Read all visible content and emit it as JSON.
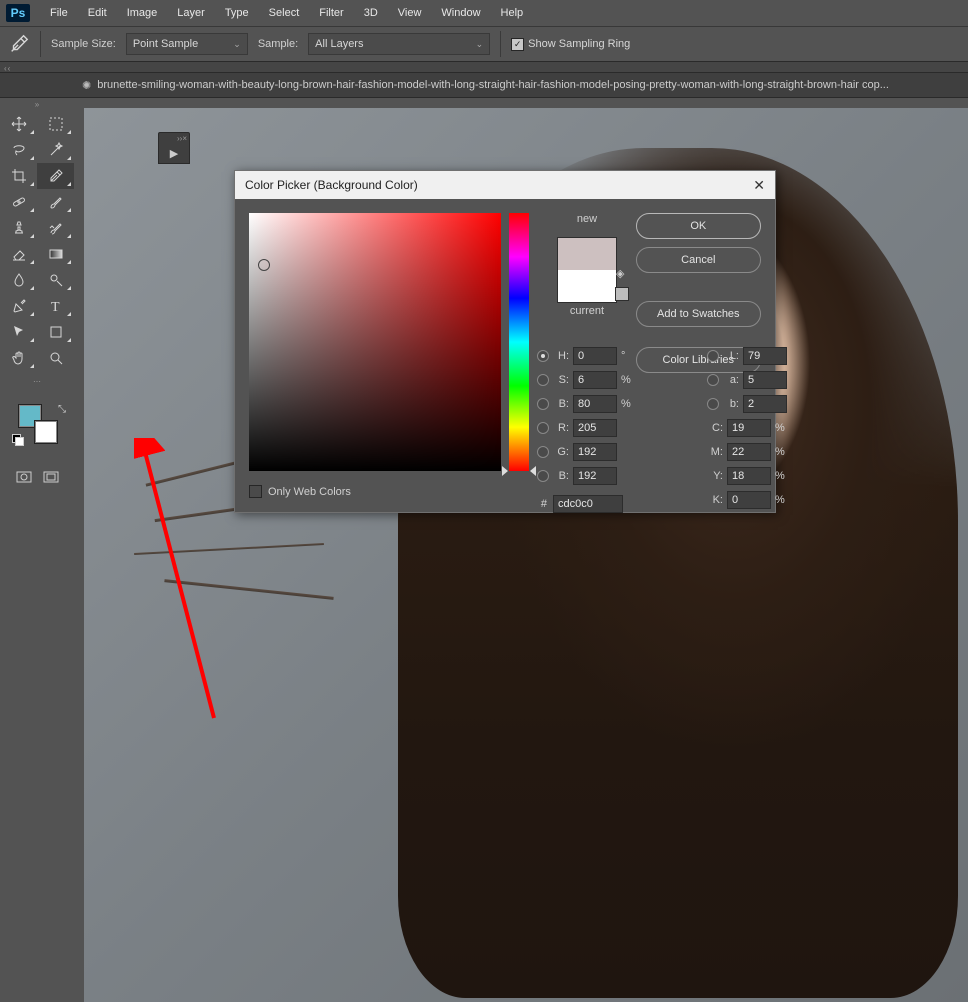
{
  "menu": {
    "items": [
      "File",
      "Edit",
      "Image",
      "Layer",
      "Type",
      "Select",
      "Filter",
      "3D",
      "View",
      "Window",
      "Help"
    ]
  },
  "options": {
    "sampleSizeLabel": "Sample Size:",
    "sampleSizeValue": "Point Sample",
    "sampleLabel": "Sample:",
    "sampleValue": "All Layers",
    "showRing": "Show Sampling Ring"
  },
  "tab": {
    "name": "brunette-smiling-woman-with-beauty-long-brown-hair-fashion-model-with-long-straight-hair-fashion-model-posing-pretty-woman-with-long-straight-brown-hair cop..."
  },
  "swatch": {
    "fg": "#64b9c8",
    "bg": "#ffffff"
  },
  "dialog": {
    "title": "Color Picker (Background Color)",
    "newLabel": "new",
    "currentLabel": "current",
    "newColor": "#cdc0c0",
    "currentColor": "#ffffff",
    "ok": "OK",
    "cancel": "Cancel",
    "addSwatch": "Add to Swatches",
    "colorLib": "Color Libraries",
    "webOnly": "Only Web Colors",
    "H": {
      "label": "H:",
      "val": "0",
      "unit": "°"
    },
    "S": {
      "label": "S:",
      "val": "6",
      "unit": "%"
    },
    "Bv": {
      "label": "B:",
      "val": "80",
      "unit": "%"
    },
    "R": {
      "label": "R:",
      "val": "205"
    },
    "G": {
      "label": "G:",
      "val": "192"
    },
    "Bc": {
      "label": "B:",
      "val": "192"
    },
    "L": {
      "label": "L:",
      "val": "79"
    },
    "a": {
      "label": "a:",
      "val": "5"
    },
    "b": {
      "label": "b:",
      "val": "2"
    },
    "C": {
      "label": "C:",
      "val": "19",
      "unit": "%"
    },
    "M": {
      "label": "M:",
      "val": "22",
      "unit": "%"
    },
    "Y": {
      "label": "Y:",
      "val": "18",
      "unit": "%"
    },
    "K": {
      "label": "K:",
      "val": "0",
      "unit": "%"
    },
    "hex": "cdc0c0",
    "svX": "6",
    "svY": "20",
    "hueY": "100"
  }
}
